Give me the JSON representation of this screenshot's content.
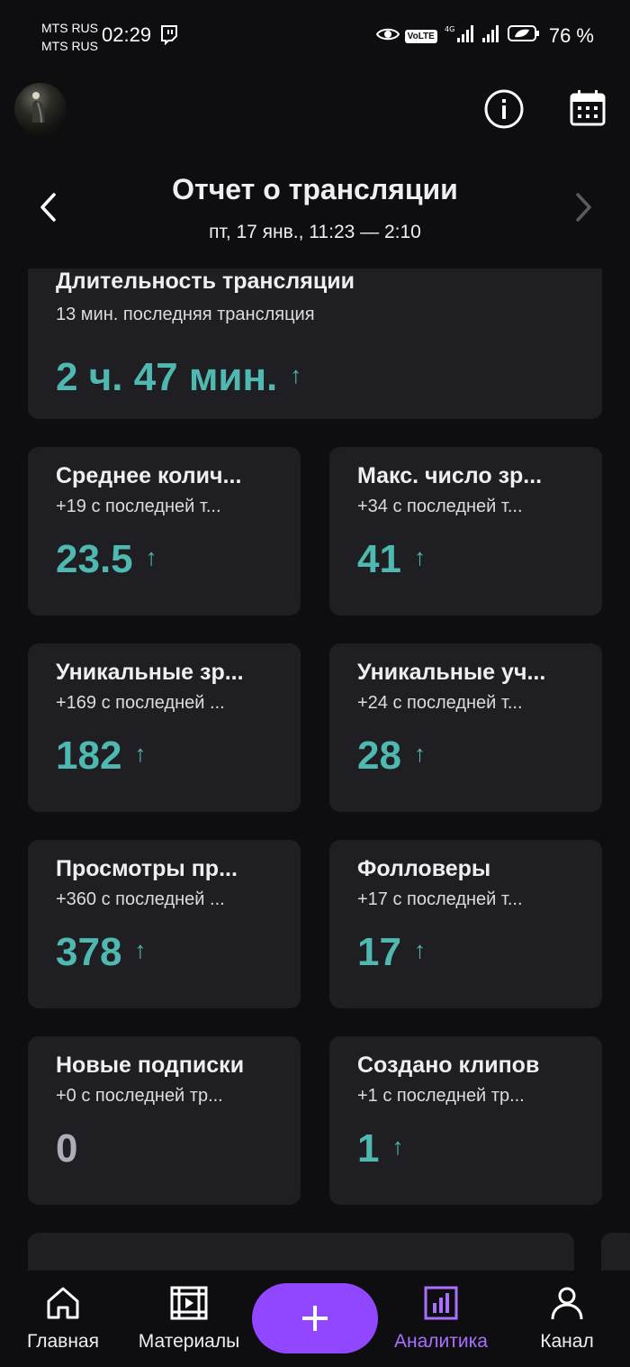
{
  "status_bar": {
    "carrier_1": "MTS RUS",
    "carrier_2": "MTS RUS",
    "time": "02:29",
    "volte": "VoLTE",
    "battery": "76 %"
  },
  "header": {
    "title": "Отчет о трансляции",
    "subtitle": "пт, 17 янв., 11:23 — 2:10"
  },
  "duration_card": {
    "title": "Длительность трансляции",
    "subtitle": "13 мин. последняя трансляция",
    "value": "2 ч. 47 мин.",
    "trend": "up"
  },
  "stats": [
    {
      "title": "Среднее колич...",
      "subtitle": "+19 с последней т...",
      "value": "23.5",
      "trend": "up"
    },
    {
      "title": "Макс. число зр...",
      "subtitle": "+34 с последней т...",
      "value": "41",
      "trend": "up"
    },
    {
      "title": "Уникальные зр...",
      "subtitle": "+169 с последней ...",
      "value": "182",
      "trend": "up"
    },
    {
      "title": "Уникальные уч...",
      "subtitle": "+24 с последней т...",
      "value": "28",
      "trend": "up"
    },
    {
      "title": "Просмотры пр...",
      "subtitle": "+360 с последней ...",
      "value": "378",
      "trend": "up"
    },
    {
      "title": "Фолловеры",
      "subtitle": "+17 с последней т...",
      "value": "17",
      "trend": "up"
    },
    {
      "title": "Новые подписки",
      "subtitle": "+0 с последней тр...",
      "value": "0",
      "trend": "none"
    },
    {
      "title": "Создано клипов",
      "subtitle": "+1 с последней тр...",
      "value": "1",
      "trend": "up"
    }
  ],
  "trend_arrow": "↑",
  "nav": {
    "home": "Главная",
    "content": "Материалы",
    "create": "+",
    "analytics": "Аналитика",
    "channel": "Канал"
  },
  "colors": {
    "accent_teal": "#4fb8b0",
    "accent_purple": "#9147ff",
    "active_nav": "#a970ff",
    "card_bg": "#1f1f23",
    "background": "#0e0e10"
  }
}
